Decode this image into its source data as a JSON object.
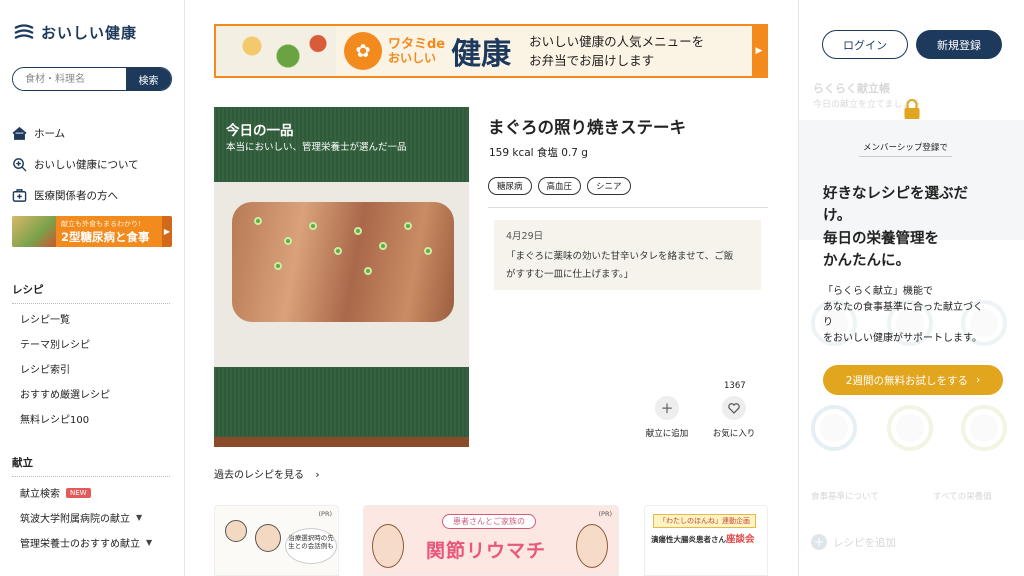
{
  "brand": {
    "name": "おいしい健康"
  },
  "search": {
    "placeholder": "食材・料理名",
    "button": "検索"
  },
  "nav": {
    "home": "ホーム",
    "about": "おいしい健康について",
    "medical": "医療関係者の方へ"
  },
  "diabetes_banner": {
    "sub": "献立も外食もまるわかり!",
    "main": "2型糖尿病と食事"
  },
  "recipe_section": {
    "heading": "レシピ",
    "items": [
      "レシピ一覧",
      "テーマ別レシピ",
      "レシピ索引",
      "おすすめ厳選レシピ",
      "無料レシピ100"
    ]
  },
  "menu_section": {
    "heading": "献立",
    "search": "献立検索",
    "new_badge": "NEW",
    "tsukuba": "筑波大学附属病院の献立",
    "dietitian": "管理栄養士のおすすめ献立"
  },
  "promo": {
    "brand_line1": "ワタミde",
    "brand_line2": "おいしい",
    "brand_big": "健康",
    "copy_line1": "おいしい健康の人気メニューを",
    "copy_line2": "お弁当でお届けします"
  },
  "featured": {
    "overlay_title": "今日の一品",
    "overlay_sub": "本当においしい、管理栄養士が選んだ一品",
    "title": "まぐろの照り焼きステーキ",
    "nutrition": "159 kcal 食塩 0.7 g",
    "tags": [
      "糖尿病",
      "高血圧",
      "シニア"
    ],
    "date": "4月29日",
    "description_line1": "「まぐろに薬味の効いた甘辛いタレを絡ませて、ご飯",
    "description_line2": "がすすむ一皿に仕上げます。」",
    "add_to_menu": "献立に追加",
    "favorite": "お気に入り",
    "favorite_count": "1367"
  },
  "past_link": "過去のレシピを見る",
  "cards": {
    "pr": "(PR)",
    "card1_note": "治療選択時の先生との会話例も",
    "card2_pill": "患者さんとご家族の",
    "card2_big": "関節リウマチ",
    "card3_ribbon": "「わたしのほんね」連動企画",
    "card3_title_prefix": "潰瘍性大腸炎患者さん",
    "card3_title_em": "座談会"
  },
  "right": {
    "login": "ログイン",
    "register": "新規登録",
    "faded_title": "らくらく献立帳",
    "faded_sub": "今日の献立を立てましょう",
    "member_label": "メンバーシップ登録で",
    "cta_heading_1": "好きなレシピを選ぶだ",
    "cta_heading_2": "け。",
    "cta_heading_3": "毎日の栄養管理を",
    "cta_heading_4": "かんたんに。",
    "cta_body_1": "「らくらく献立」機能で",
    "cta_body_2": "あなたの食事基準に合った献立づく",
    "cta_body_3": "り",
    "cta_body_4": "をおいしい健康がサポートします。",
    "cta_button": "2週間の無料お試しをする",
    "faded_link_left": "食事基準について",
    "faded_link_right": "すべての栄養価",
    "faded_add": "レシピを追加"
  },
  "colors": {
    "navy": "#1d3a5c",
    "orange": "#f28a1e",
    "gold": "#e2a51e",
    "pink": "#e8577d"
  }
}
